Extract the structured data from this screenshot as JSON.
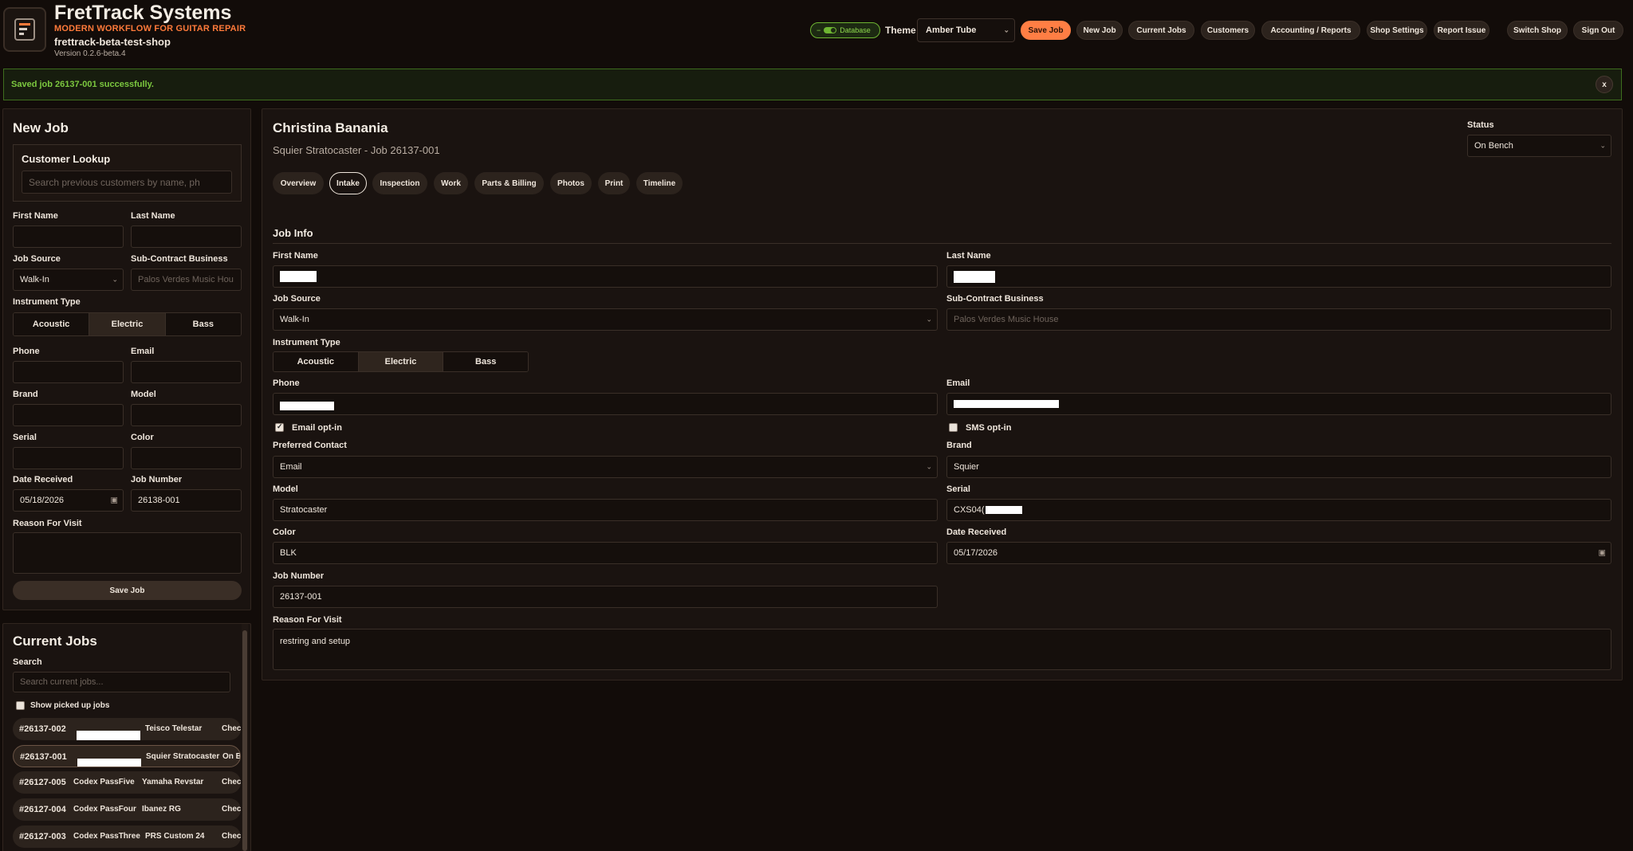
{
  "header": {
    "title": "FretTrack Systems",
    "tagline": "MODERN WORKFLOW FOR GUITAR REPAIR",
    "shop": "frettrack-beta-test-shop",
    "version": "Version 0.2.6-beta.4",
    "db_label": "Database",
    "theme_label": "Theme",
    "theme_value": "Amber Tube",
    "nav": {
      "save_job": "Save Job",
      "new_job": "New Job",
      "current_jobs": "Current Jobs",
      "customers": "Customers",
      "accounting": "Accounting / Reports",
      "shop_settings": "Shop Settings",
      "report_issue": "Report Issue",
      "switch_shop": "Switch Shop",
      "sign_out": "Sign Out"
    },
    "colors": {
      "accent": "#ff7e44",
      "success": "#7cc83f"
    }
  },
  "alert": {
    "message": "Saved job 26137-001 successfully.",
    "close": "x"
  },
  "new_job": {
    "title": "New Job",
    "lookup_title": "Customer Lookup",
    "lookup_placeholder": "Search previous customers by name, ph",
    "first_name_label": "First Name",
    "last_name_label": "Last Name",
    "job_source_label": "Job Source",
    "job_source_value": "Walk-In",
    "subcontract_label": "Sub-Contract Business",
    "subcontract_placeholder": "Palos Verdes Music Hou",
    "instrument_label": "Instrument Type",
    "instrument_options": [
      "Acoustic",
      "Electric",
      "Bass"
    ],
    "phone_label": "Phone",
    "email_label": "Email",
    "brand_label": "Brand",
    "model_label": "Model",
    "serial_label": "Serial",
    "color_label": "Color",
    "date_label": "Date Received",
    "date_value": "05/18/2026",
    "job_number_label": "Job Number",
    "job_number_value": "26138-001",
    "reason_label": "Reason For Visit",
    "save_label": "Save Job"
  },
  "current_jobs": {
    "title": "Current Jobs",
    "search_label": "Search",
    "search_placeholder": "Search current jobs...",
    "show_picked_label": "Show picked up jobs",
    "rows": [
      {
        "num": "#26137-002",
        "customer": "",
        "instrument": "Teisco Telestar",
        "status": "Chec"
      },
      {
        "num": "#26137-001",
        "customer": "",
        "instrument": "Squier Stratocaster",
        "status": "On B"
      },
      {
        "num": "#26127-005",
        "customer": "Codex PassFive",
        "instrument": "Yamaha Revstar",
        "status": "Chec"
      },
      {
        "num": "#26127-004",
        "customer": "Codex PassFour",
        "instrument": "Ibanez RG",
        "status": "Chec"
      },
      {
        "num": "#26127-003",
        "customer": "Codex PassThree",
        "instrument": "PRS Custom 24",
        "status": "Chec"
      }
    ]
  },
  "job": {
    "customer_name": "Christina Banania",
    "subtitle": "Squier Stratocaster - Job 26137-001",
    "status_label": "Status",
    "status_value": "On Bench",
    "tabs": [
      "Overview",
      "Intake",
      "Inspection",
      "Work",
      "Parts & Billing",
      "Photos",
      "Print",
      "Timeline"
    ],
    "active_tab": "Intake",
    "section_title": "Job Info",
    "first_name_label": "First Name",
    "last_name_label": "Last Name",
    "job_source_label": "Job Source",
    "job_source_value": "Walk-In",
    "subcontract_label": "Sub-Contract Business",
    "subcontract_placeholder": "Palos Verdes Music House",
    "instrument_label": "Instrument Type",
    "instrument_options": [
      "Acoustic",
      "Electric",
      "Bass"
    ],
    "phone_label": "Phone",
    "email_label": "Email",
    "email_optin_label": "Email opt-in",
    "sms_optin_label": "SMS opt-in",
    "preferred_label": "Preferred Contact",
    "preferred_value": "Email",
    "brand_label": "Brand",
    "brand_value": "Squier",
    "model_label": "Model",
    "model_value": "Stratocaster",
    "serial_label": "Serial",
    "serial_value": "CXS04(",
    "color_label": "Color",
    "color_value": "BLK",
    "date_label": "Date Received",
    "date_value": "05/17/2026",
    "job_number_label": "Job Number",
    "job_number_value": "26137-001",
    "reason_label": "Reason For Visit",
    "reason_value": "restring and setup"
  }
}
